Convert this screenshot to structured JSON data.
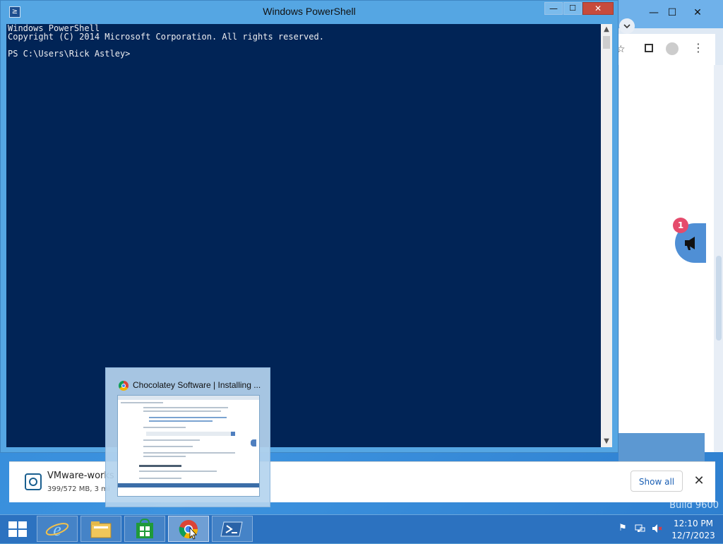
{
  "powershell": {
    "title": "Windows PowerShell",
    "console_lines": [
      "Windows PowerShell",
      "Copyright (C) 2014 Microsoft Corporation. All rights reserved.",
      "",
      "PS C:\\Users\\Rick Astley>"
    ],
    "minimize_glyph": "—",
    "maximize_glyph": "☐",
    "close_glyph": "✕"
  },
  "chrome_behind": {
    "notification_count": "1"
  },
  "download_bar": {
    "file_name": "VMware-works",
    "status": "399/572 MB, 3 mi",
    "show_all_label": "Show all",
    "close_glyph": "✕"
  },
  "preview": {
    "title": "Chocolatey Software | Installing ..."
  },
  "desktop": {
    "build_text": "Build 9600"
  },
  "taskbar": {
    "items": [
      "internet-explorer",
      "file-explorer",
      "store",
      "chrome",
      "powershell"
    ],
    "active_item": "chrome",
    "time": "12:10 PM",
    "date": "12/7/2023"
  },
  "colors": {
    "console_bg": "#012456",
    "titlebar": "#55a6e3",
    "close_red": "#c74b3c",
    "taskbar": "#286ebe"
  }
}
